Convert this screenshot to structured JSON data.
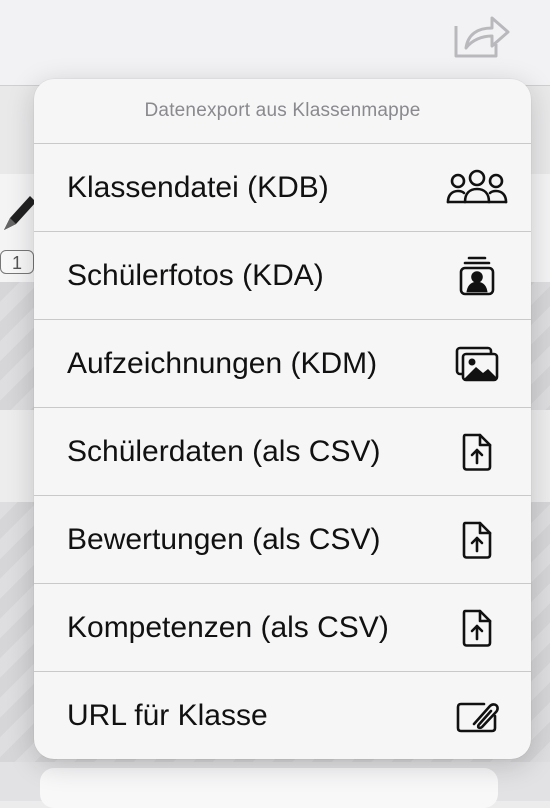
{
  "background": {
    "badge_text": "1"
  },
  "popover": {
    "title": "Datenexport aus Klassenmappe",
    "items": [
      {
        "label": "Klassendatei (KDB)",
        "icon": "group-icon"
      },
      {
        "label": "Schülerfotos (KDA)",
        "icon": "portrait-stack-icon"
      },
      {
        "label": "Aufzeichnungen (KDM)",
        "icon": "photos-icon"
      },
      {
        "label": "Schülerdaten (als CSV)",
        "icon": "document-upload-icon"
      },
      {
        "label": "Bewertungen (als CSV)",
        "icon": "document-upload-icon"
      },
      {
        "label": "Kompetenzen (als CSV)",
        "icon": "document-upload-icon"
      },
      {
        "label": "URL für Klasse",
        "icon": "link-card-icon"
      }
    ]
  }
}
